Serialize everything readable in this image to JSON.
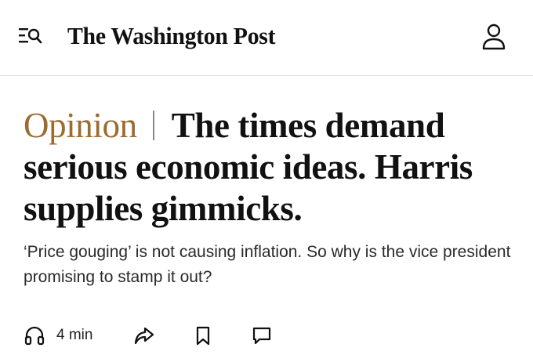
{
  "header": {
    "masthead": "The Washington Post",
    "menu_icon": "menu-search-icon",
    "account_icon": "user-icon"
  },
  "article": {
    "kicker": "Opinion",
    "headline": "The times demand serious economic ideas. Harris supplies gimmicks.",
    "dek": "‘Price gouging’ is not causing inflation. So why is the vice president promising to stamp it out?",
    "listen_time": "4 min"
  },
  "actions": {
    "listen_icon": "headphones-icon",
    "share_icon": "share-icon",
    "save_icon": "bookmark-icon",
    "comment_icon": "comment-icon"
  },
  "colors": {
    "kicker": "#9c6b2e",
    "text": "#111111",
    "divider": "#dcdcdc"
  }
}
